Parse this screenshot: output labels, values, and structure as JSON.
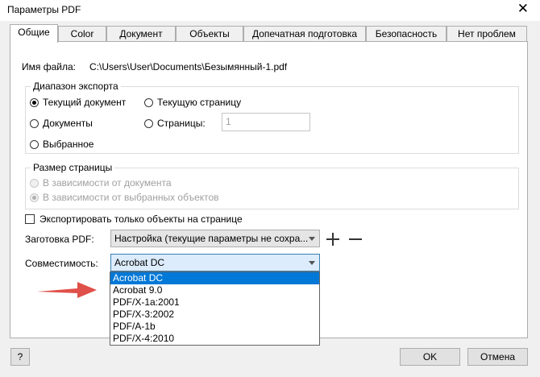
{
  "window": {
    "title": "Параметры PDF"
  },
  "tabs": [
    {
      "label": "Общие"
    },
    {
      "label": "Color"
    },
    {
      "label": "Документ"
    },
    {
      "label": "Объекты"
    },
    {
      "label": "Допечатная подготовка"
    },
    {
      "label": "Безопасность"
    },
    {
      "label": "Нет проблем"
    }
  ],
  "file": {
    "label": "Имя файла:",
    "value": "C:\\Users\\User\\Documents\\Безымянный-1.pdf"
  },
  "export_range": {
    "legend": "Диапазон экспорта",
    "current_document": "Текущий документ",
    "current_page": "Текущую страницу",
    "documents": "Документы",
    "pages": "Страницы:",
    "pages_value": "1",
    "selection": "Выбранное"
  },
  "page_size": {
    "legend": "Размер страницы",
    "from_document": "В зависимости от документа",
    "from_objects": "В зависимости от выбранных объектов"
  },
  "export_only_on_page": "Экспортировать только объекты на странице",
  "preset": {
    "label": "Заготовка PDF:",
    "value": "Настройка (текущие параметры не сохра..."
  },
  "compat": {
    "label": "Совместимость:",
    "value": "Acrobat DC",
    "options": [
      "Acrobat DC",
      "Acrobat 9.0",
      "PDF/X-1a:2001",
      "PDF/X-3:2002",
      "PDF/A-1b",
      "PDF/X-4:2010"
    ]
  },
  "buttons": {
    "help": "?",
    "ok": "OK",
    "cancel": "Отмена"
  },
  "colors": {
    "arrow": "#e0504a",
    "selection": "#0078d7",
    "focus": "#3c7fb1"
  }
}
